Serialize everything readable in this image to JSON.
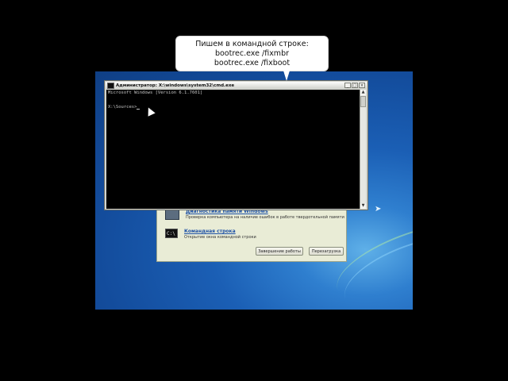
{
  "callout": {
    "line1": "Пишем в командной строке:",
    "line2": "bootrec.exe /fixmbr",
    "line3": "bootrec.exe /fixboot"
  },
  "cmd_window": {
    "title": "Администратор: X:\\windows\\system32\\cmd.exe",
    "line1": "Microsoft Windows [Version 6.1.7601]",
    "prompt": "X:\\Sources>",
    "buttons": {
      "minimize": "_",
      "maximize": "□",
      "close": "×"
    }
  },
  "recovery_window": {
    "item1_title": "Диагностика памяти Windows",
    "item1_desc": "Проверка компьютера на наличие ошибок в работе твердотельной памяти",
    "item2_title": "Командная строка",
    "item2_desc": "Открытие окна командной строки",
    "shutdown_label": "Завершение работы",
    "restart_label": "Перезагрузка",
    "cmd_icon_text": "C:\\"
  },
  "colors": {
    "desktop": "#134c9c",
    "console_bg": "#000000",
    "console_fg": "#c8c8c8",
    "link": "#1b4fa5"
  },
  "icons": [
    "cmd-window-icon",
    "memory-diagnostic-icon",
    "command-prompt-icon",
    "mouse-pointer-icon",
    "windows-bird-icon"
  ]
}
